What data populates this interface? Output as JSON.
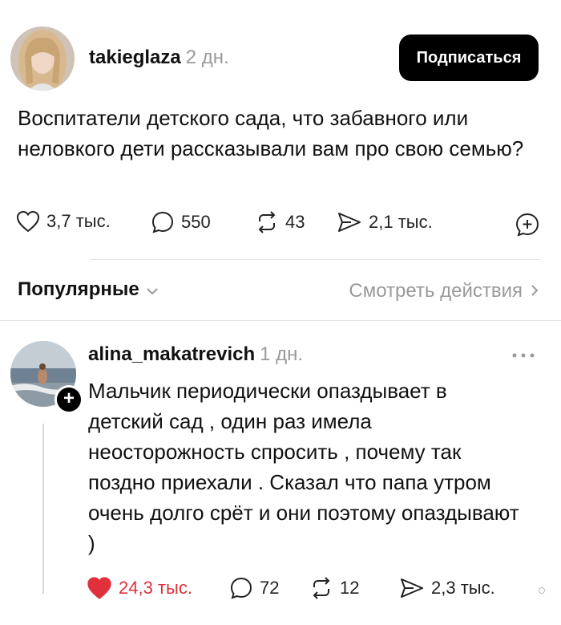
{
  "post": {
    "author": "takieglaza",
    "time": "2 дн.",
    "follow_label": "Подписаться",
    "text": "Воспитатели детского сада, что забавного или неловкого дети рассказывали вам про свою семью?",
    "likes": "3,7 тыс.",
    "comments": "550",
    "reposts": "43",
    "shares": "2,1 тыс."
  },
  "sort_bar": {
    "sort_label": "Популярные",
    "activity_label": "Смотреть действия"
  },
  "comment": {
    "author": "alina_makatrevich",
    "time": "1 дн.",
    "text": "Мальчик периодически опаздывает в детский сад , один раз имела неосторожность спросить , почему так поздно приехали . Сказал что папа утром очень долго срёт и они поэтому опаздывают )",
    "likes": "24,3 тыс.",
    "comments": "72",
    "reposts": "12",
    "shares": "2,3 тыс.",
    "liked": true
  },
  "colors": {
    "accent_like": "#e0303c",
    "muted": "#9a9a9a",
    "button_bg": "#000000"
  },
  "icons": [
    "heart-icon",
    "comment-icon",
    "repost-icon",
    "share-icon",
    "add-circle-icon",
    "chevron-down-icon",
    "chevron-right-icon",
    "more-icon",
    "plus-icon"
  ]
}
